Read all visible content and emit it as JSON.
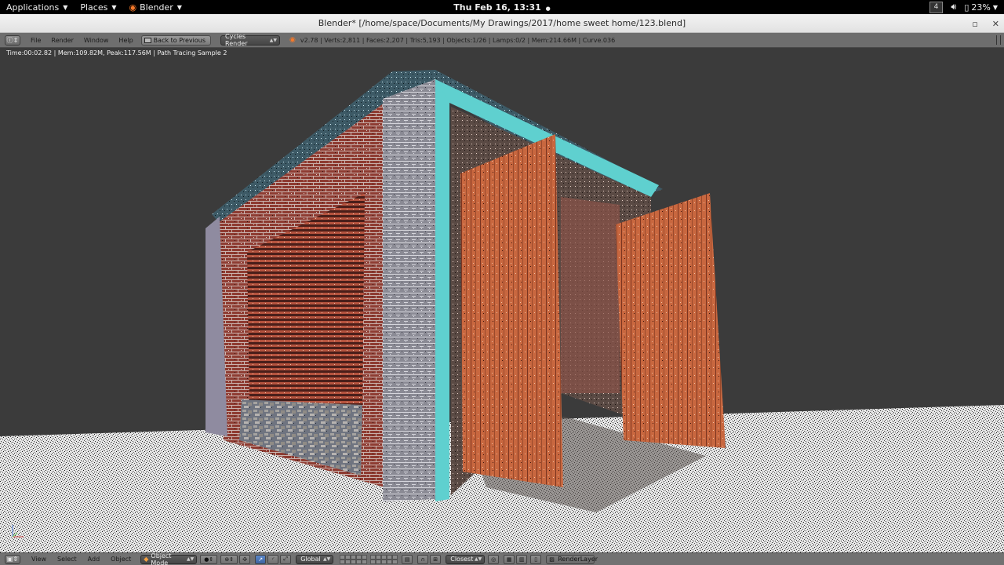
{
  "topbar": {
    "applications_label": "Applications",
    "places_label": "Places",
    "app_label": "Blender",
    "clock": "Thu Feb 16, 13:31",
    "workspace_number": "4",
    "battery_percent": "23%"
  },
  "window": {
    "title": "Blender* [/home/space/Documents/My Drawings/2017/home sweet home/123.blend]"
  },
  "info_header": {
    "menus": [
      "File",
      "Render",
      "Window",
      "Help"
    ],
    "back_button_label": "Back to Previous",
    "render_engine": "Cycles Render",
    "stats": "v2.78 | Verts:2,811 | Faces:2,207 | Tris:5,193 | Objects:1/26 | Lamps:0/2 | Mem:214.66M | Curve.036"
  },
  "viewport": {
    "render_status": "Time:00:02.82 | Mem:109.82M, Peak:117.56M | Path Tracing Sample 2"
  },
  "view3d_header": {
    "menus": [
      "View",
      "Select",
      "Add",
      "Object"
    ],
    "mode": "Object Mode",
    "orientation": "Global",
    "snap_target": "Closest",
    "render_layer": "RenderLayer"
  },
  "colors": {
    "viewport_bg": "#3b3b3b",
    "floor": "#d4d4d4",
    "brick": "#9a3f34",
    "door_wood": "#c9663e",
    "edge_highlight": "#5fd0cf",
    "blender_orange": "#f5792a"
  }
}
